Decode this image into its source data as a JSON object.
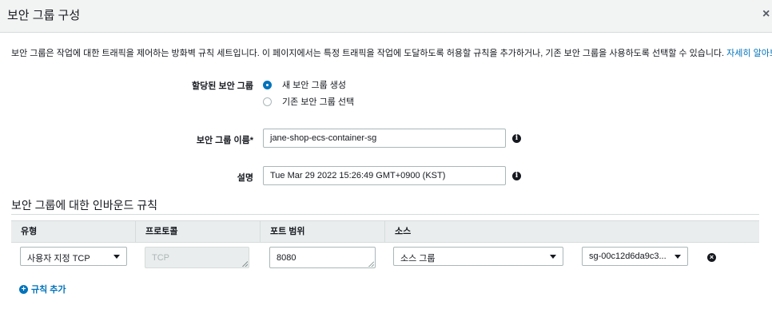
{
  "header": {
    "title": "보안 그룹 구성",
    "close_glyph": "×"
  },
  "description": {
    "text": "보안 그룹은 작업에 대한 트래픽을 제어하는 방화벽 규칙 세트입니다. 이 페이지에서는 특정 트래픽을 작업에 도달하도록 허용할 규칙을 추가하거나, 기존 보안 그룹을 사용하도록 선택할 수 있습니다. ",
    "link": "자세히 알아보기",
    "link_suffix": "."
  },
  "assigned_sg": {
    "label": "할당된 보안 그룹",
    "options": [
      {
        "label": "새 보안 그룹 생성",
        "selected": true
      },
      {
        "label": "기존 보안 그룹 선택",
        "selected": false
      }
    ]
  },
  "sg_name": {
    "label": "보안 그룹 이름*",
    "value": "jane-shop-ecs-container-sg"
  },
  "sg_desc": {
    "label": "설명",
    "value": "Tue Mar 29 2022 15:26:49 GMT+0900 (KST)"
  },
  "info_glyph": "i",
  "inbound": {
    "title": "보안 그룹에 대한 인바운드 규칙",
    "columns": [
      "유형",
      "프로토콜",
      "포트 범위",
      "소스"
    ],
    "rule": {
      "type": "사용자 지정 TCP",
      "protocol": "TCP",
      "port": "8080",
      "source_type": "소스 그룹",
      "source_value": "sg-00c12d6da9c3..."
    },
    "remove_glyph": "×",
    "add_rule": "규칙 추가",
    "add_glyph": "+"
  },
  "colors": {
    "accent": "#0073bb",
    "header_bg": "#f2f3f3",
    "table_header_bg": "#eaeded"
  }
}
